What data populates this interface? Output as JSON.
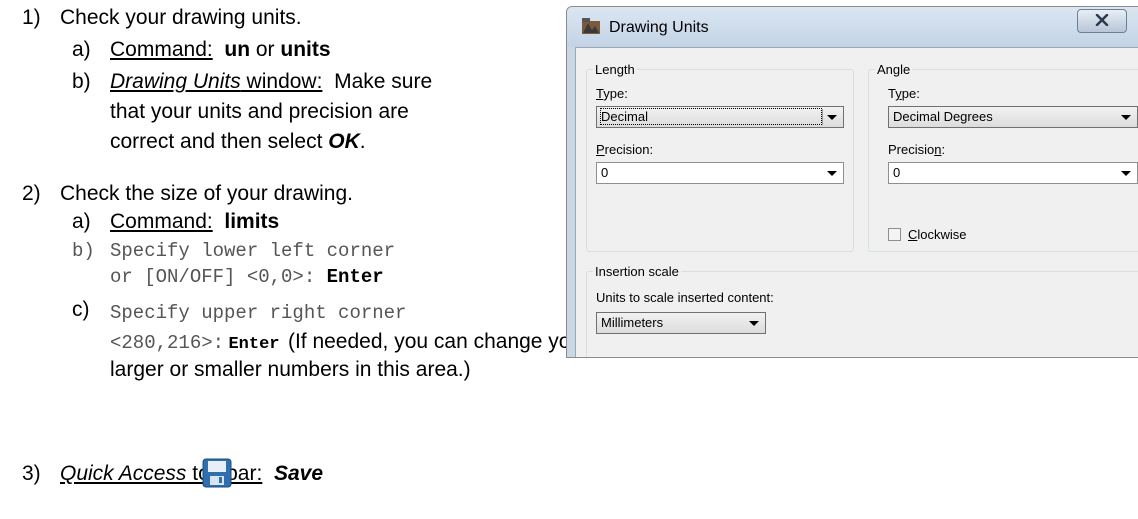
{
  "doc": {
    "s1_num": "1)",
    "s1_text": "Check your drawing units.",
    "s1a_letter": "a)",
    "s1a_cmd": "Command:",
    "s1a_un": "un",
    "s1a_or": "or",
    "s1a_units": "units",
    "s1b_letter": "b)",
    "s1b_dw": "Drawing Units",
    "s1b_window": " window:",
    "s1b_rest1": "Make sure",
    "s1b_rest2": "that your units and precision are",
    "s1b_rest3": "correct and then select",
    "s1b_ok": "OK",
    "s2_num": "2)",
    "s2_text": "Check the size of your drawing.",
    "s2a_letter": "a)",
    "s2a_cmd": "Command:",
    "s2a_limits": "limits",
    "s2b_letter": "b)",
    "s2b_line1": "Specify lower left corner",
    "s2b_line2": "or [ON/OFF] <0,0>:",
    "s2b_enter": "Enter",
    "s2c_letter": "c)",
    "s2c_line1": "Specify upper right corner",
    "s2c_line2": "<280,216>:",
    "s2c_enter": "Enter",
    "s2c_note1": "(If needed, you can change your drawing size by entering",
    "s2c_note2": "larger or smaller numbers in this area.)",
    "s3_num": "3)",
    "s3_qa": "Quick Access",
    "s3_toolbar": " toolbar:",
    "s3_save": "Save",
    "save_icon": "floppy-disk-icon"
  },
  "dialog": {
    "title": "Drawing Units",
    "close": "X",
    "length_legend": "Length",
    "length_type_label": "Type:",
    "length_type_value": "Decimal",
    "length_precision_label": "Precision:",
    "length_precision_value": "0",
    "angle_legend": "Angle",
    "angle_type_label": "Type:",
    "angle_type_value": "Decimal Degrees",
    "angle_precision_label": "Precision:",
    "angle_precision_value": "0",
    "clockwise_label": "Clockwise",
    "clockwise_checked": false,
    "insertion_legend": "Insertion scale",
    "insertion_label": "Units to scale inserted content:",
    "insertion_value": "Millimeters"
  }
}
